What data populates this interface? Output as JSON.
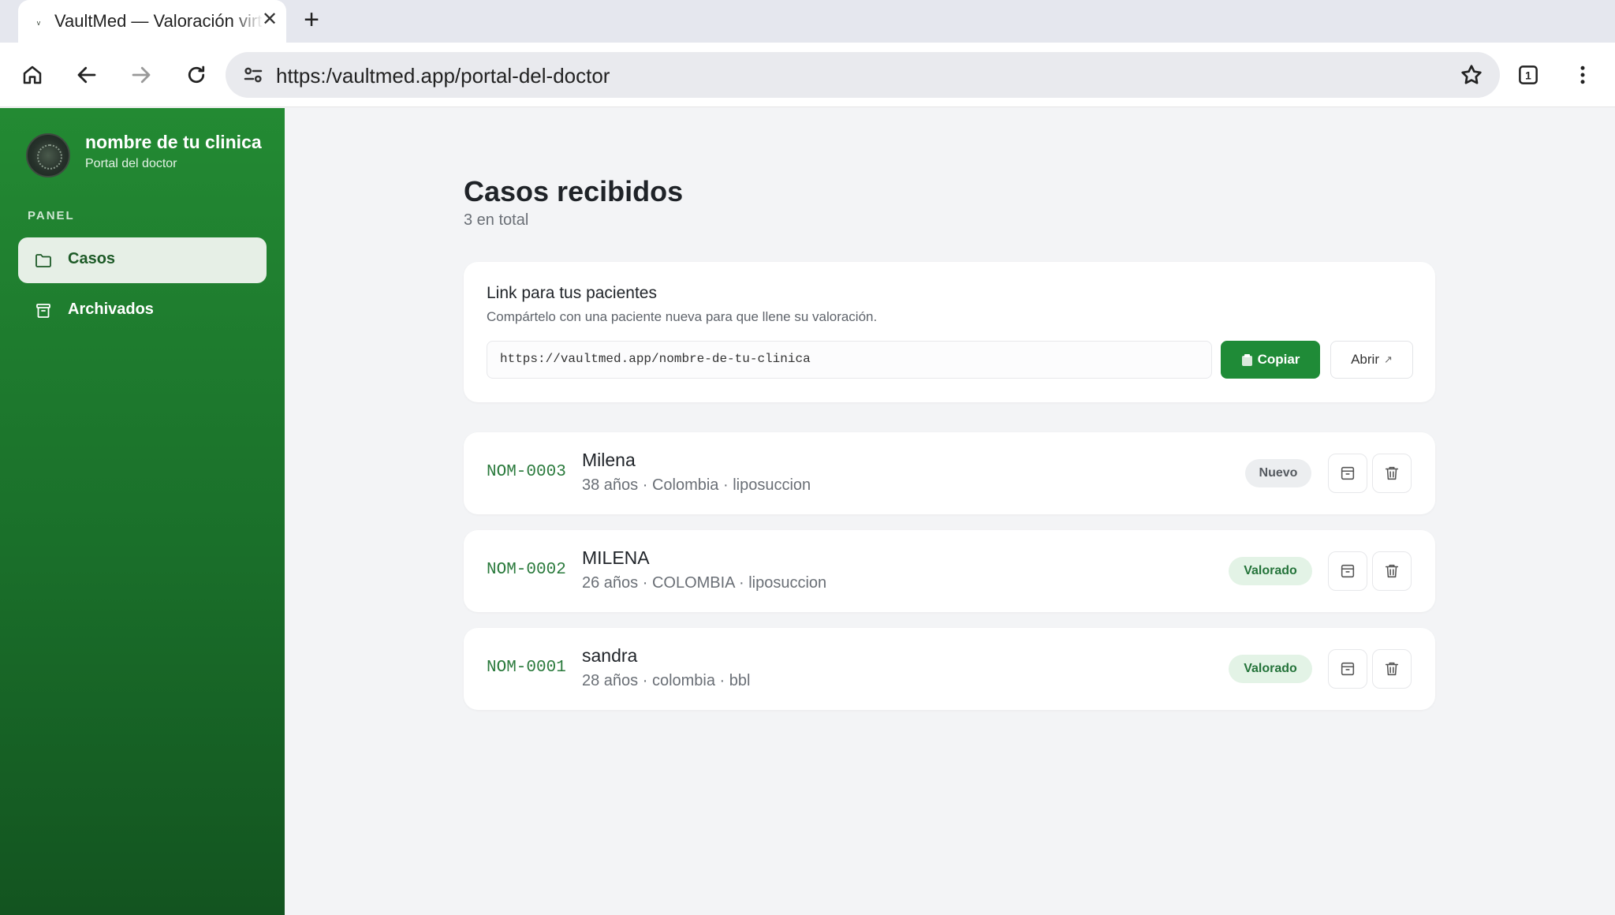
{
  "browser": {
    "tab_title": "VaultMed — Valoración virtual",
    "url": "https:/vaultmed.app/portal-del-doctor",
    "tab_count": "1"
  },
  "sidebar": {
    "clinic_name": "nombre de tu clinica",
    "subtitle": "Portal del doctor",
    "section_label": "PANEL",
    "items": [
      {
        "label": "Casos",
        "icon": "folder-icon",
        "active": true
      },
      {
        "label": "Archivados",
        "icon": "archive-icon",
        "active": false
      }
    ]
  },
  "main": {
    "title": "Casos recibidos",
    "count": "3 en total",
    "link_card": {
      "title": "Link para tus pacientes",
      "description": "Compártelo con una paciente nueva para que llene su valoración.",
      "link": "https://vaultmed.app/nombre-de-tu-clinica",
      "copy_label": "Copiar",
      "open_label": "Abrir"
    },
    "cases": [
      {
        "code": "NOM-0003",
        "name": "Milena",
        "meta": "38 años · Colombia · liposuccion",
        "status": "Nuevo"
      },
      {
        "code": "NOM-0002",
        "name": "MILENA",
        "meta": "26 años · COLOMBIA · liposuccion",
        "status": "Valorado"
      },
      {
        "code": "NOM-0001",
        "name": "sandra",
        "meta": "28 años · colombia · bbl",
        "status": "Valorado"
      }
    ]
  },
  "colors": {
    "brand_green": "#1f8b37",
    "sidebar_top": "#238a33",
    "sidebar_bottom": "#135420"
  }
}
